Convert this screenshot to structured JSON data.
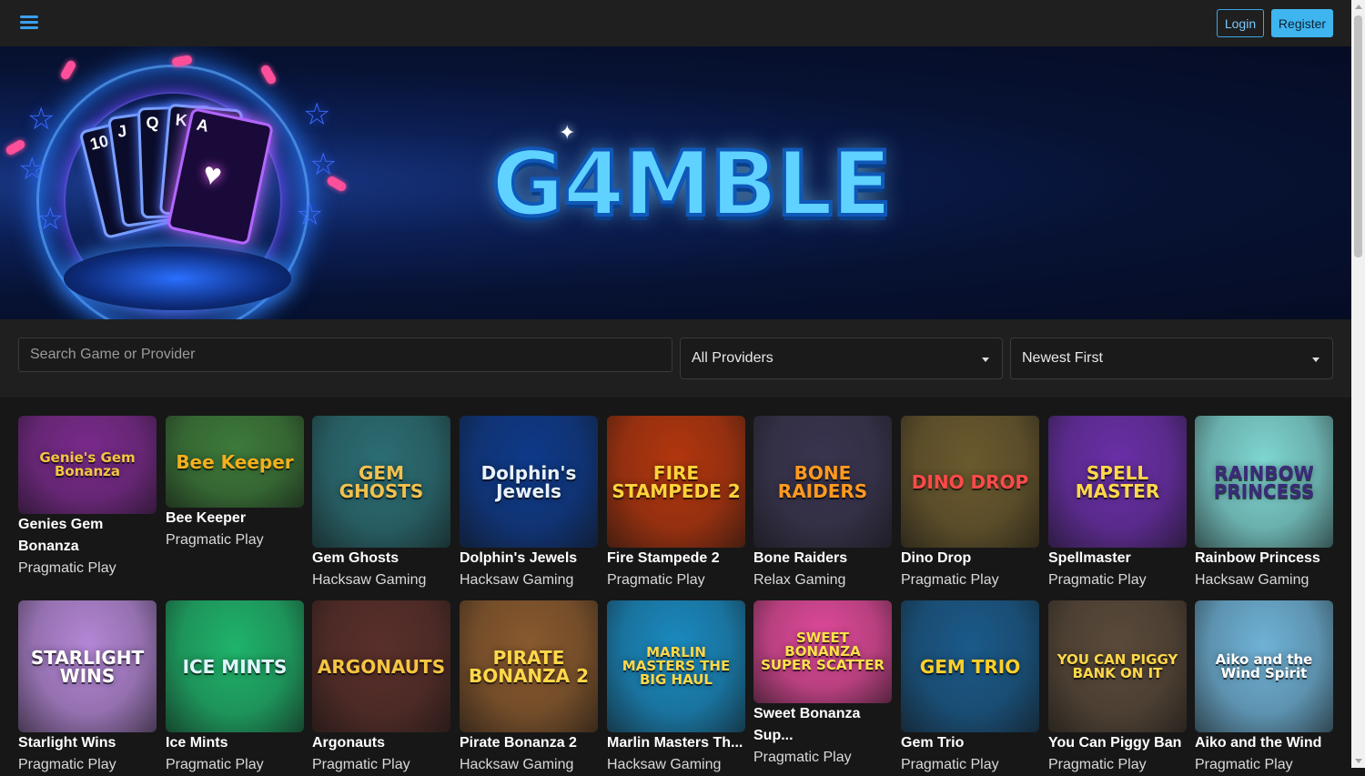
{
  "header": {
    "login_label": "Login",
    "register_label": "Register"
  },
  "banner": {
    "logo_text": "G4MBLE",
    "cards": [
      "10",
      "J",
      "Q",
      "K",
      "A"
    ]
  },
  "filters": {
    "search_placeholder": "Search Game or Provider",
    "provider_selected": "All Providers",
    "sort_selected": "Newest First"
  },
  "games": [
    {
      "name": "Genies Gem Bonanza",
      "provider": "Pragmatic Play",
      "art_text": "Genie's Gem Bonanza",
      "bg": "#7a2a8c",
      "accent": "#f5c542"
    },
    {
      "name": "Bee Keeper",
      "provider": "Pragmatic Play",
      "art_text": "Bee Keeper",
      "bg": "#3d7a3a",
      "accent": "#f2b01e"
    },
    {
      "name": "Gem Ghosts",
      "provider": "Hacksaw Gaming",
      "art_text": "GEM GHOSTS",
      "bg": "#2b6e74",
      "accent": "#f2c14e"
    },
    {
      "name": "Dolphin's Jewels",
      "provider": "Hacksaw Gaming",
      "art_text": "Dolphin's Jewels",
      "bg": "#0e3a8a",
      "accent": "#e8f2ff"
    },
    {
      "name": "Fire Stampede 2",
      "provider": "Pragmatic Play",
      "art_text": "FIRE STAMPEDE 2",
      "bg": "#b3360e",
      "accent": "#ffd23a"
    },
    {
      "name": "Bone Raiders",
      "provider": "Relax Gaming",
      "art_text": "BONE RAIDERS",
      "bg": "#3a3550",
      "accent": "#ff9a1f"
    },
    {
      "name": "Dino Drop",
      "provider": "Pragmatic Play",
      "art_text": "DINO DROP",
      "bg": "#6b5a2e",
      "accent": "#ff4a4a"
    },
    {
      "name": "Spellmaster",
      "provider": "Pragmatic Play",
      "art_text": "SPELL MASTER",
      "bg": "#6a2fa8",
      "accent": "#ffd84a"
    },
    {
      "name": "Rainbow Princess",
      "provider": "Hacksaw Gaming",
      "art_text": "RAINBOW PRINCESS",
      "bg": "#7fd6d3",
      "accent": "#3b2a7a"
    },
    {
      "name": "Starlight Wins",
      "provider": "Pragmatic Play",
      "art_text": "STARLIGHT WINS",
      "bg": "#b487d6",
      "accent": "#ffffff"
    },
    {
      "name": "Ice Mints",
      "provider": "Pragmatic Play",
      "art_text": "ICE MINTS",
      "bg": "#1fb36b",
      "accent": "#dff6ff"
    },
    {
      "name": "Argonauts",
      "provider": "Pragmatic Play",
      "art_text": "ARGONAUTS",
      "bg": "#5a2f2a",
      "accent": "#f5c542"
    },
    {
      "name": "Pirate Bonanza 2",
      "provider": "Hacksaw Gaming",
      "art_text": "PIRATE BONANZA 2",
      "bg": "#8a5a2e",
      "accent": "#ffd84a"
    },
    {
      "name": "Marlin Masters Th...",
      "provider": "Hacksaw Gaming",
      "art_text": "MARLIN MASTERS THE BIG HAUL",
      "bg": "#1a8ac0",
      "accent": "#ffd84a"
    },
    {
      "name": "Sweet Bonanza Sup...",
      "provider": "Pragmatic Play",
      "art_text": "SWEET BONANZA SUPER SCATTER",
      "bg": "#e04a9a",
      "accent": "#ffe14a"
    },
    {
      "name": "Gem Trio",
      "provider": "Pragmatic Play",
      "art_text": "GEM TRIO",
      "bg": "#1a5a8a",
      "accent": "#ffcf2a"
    },
    {
      "name": "You Can Piggy Ban",
      "provider": "Pragmatic Play",
      "art_text": "YOU CAN PIGGY BANK ON IT",
      "bg": "#5a4a3a",
      "accent": "#ffd84a"
    },
    {
      "name": "Aiko and the Wind",
      "provider": "Pragmatic Play",
      "art_text": "Aiko and the Wind Spirit",
      "bg": "#6fb2d6",
      "accent": "#ffffff"
    }
  ]
}
